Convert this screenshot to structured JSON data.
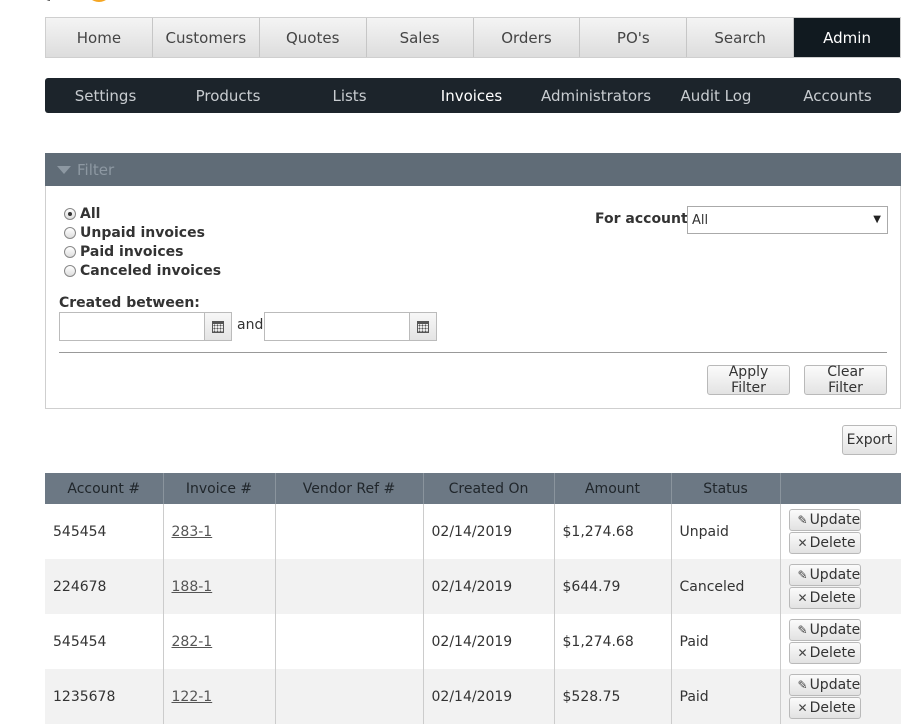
{
  "main_nav": [
    "Home",
    "Customers",
    "Quotes",
    "Sales",
    "Orders",
    "PO's",
    "Search",
    "Admin"
  ],
  "main_nav_active": "Admin",
  "sub_nav": [
    "Settings",
    "Products",
    "Lists",
    "Invoices",
    "Administrators",
    "Audit Log",
    "Accounts"
  ],
  "sub_nav_active": "Invoices",
  "filter": {
    "header": "Filter",
    "radios": [
      {
        "label": "All",
        "checked": true
      },
      {
        "label": "Unpaid invoices",
        "checked": false
      },
      {
        "label": "Paid invoices",
        "checked": false
      },
      {
        "label": "Canceled invoices",
        "checked": false
      }
    ],
    "account_label": "For account:",
    "account_value": "All",
    "created_label": "Created between:",
    "and_label": "and",
    "apply_label": "Apply Filter",
    "clear_label": "Clear Filter"
  },
  "export_label": "Export",
  "table": {
    "columns": [
      "Account #",
      "Invoice #",
      "Vendor Ref #",
      "Created On",
      "Amount",
      "Status",
      ""
    ],
    "rows": [
      {
        "account": "545454",
        "invoice": "283-1",
        "vendor_ref": "",
        "created": "02/14/2019",
        "amount": "$1,274.68",
        "status": "Unpaid"
      },
      {
        "account": "224678",
        "invoice": "188-1",
        "vendor_ref": "",
        "created": "02/14/2019",
        "amount": "$644.79",
        "status": "Canceled"
      },
      {
        "account": "545454",
        "invoice": "282-1",
        "vendor_ref": "",
        "created": "02/14/2019",
        "amount": "$1,274.68",
        "status": "Paid"
      },
      {
        "account": "1235678",
        "invoice": "122-1",
        "vendor_ref": "",
        "created": "02/14/2019",
        "amount": "$528.75",
        "status": "Paid"
      }
    ],
    "update_label": "Update",
    "delete_label": "Delete"
  }
}
